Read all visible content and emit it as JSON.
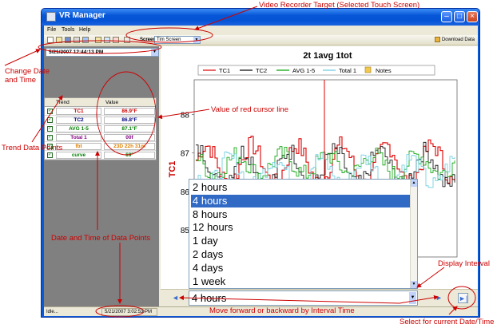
{
  "window": {
    "title": "VR Manager",
    "minimize_glyph": "–",
    "maximize_glyph": "□",
    "close_glyph": "×"
  },
  "menu": {
    "file": "File",
    "tools": "Tools",
    "help": "Help"
  },
  "toolbar": {
    "screen_label": "Screen:",
    "screen_value": "Tim Screen",
    "download_label": "Download Data",
    "dropdown_glyph": "▼"
  },
  "left": {
    "date_value": "5/21/2007 12:44:13 PM",
    "table_headers": {
      "trend": "Trend",
      "value": "Value"
    },
    "check_glyph": "✓",
    "trends": [
      {
        "name": "TC1",
        "value": "86.9°F",
        "color": "#cc0000"
      },
      {
        "name": "TC2",
        "value": "86.8°F",
        "color": "#000080"
      },
      {
        "name": "AVG 1-5",
        "value": "87.1°F",
        "color": "#008000"
      },
      {
        "name": "Total 1",
        "value": "00f",
        "color": "#800080"
      },
      {
        "name": "fbt",
        "value": "23D 22h 31m",
        "color": "#e08000"
      },
      {
        "name": "curve",
        "value": "69°",
        "color": "#008000"
      }
    ]
  },
  "status": {
    "left": "Idle...",
    "right": "5/21/2007 3:02:53 PM"
  },
  "chart": {
    "legend": {
      "tc1": "TC1",
      "tc2": "TC2",
      "avg": "AVG 1-5",
      "total": "Total 1",
      "notes": "Notes"
    }
  },
  "chart_data": {
    "type": "line",
    "title": "2t 1avg 1tot",
    "ylabel": "TC1",
    "y_ticks": [
      85,
      86,
      87,
      88
    ],
    "ylim": [
      84.3,
      88.9
    ],
    "cursor_y": 88.5,
    "series": [
      {
        "name": "TC1",
        "color": "#dd0000"
      },
      {
        "name": "TC2",
        "color": "#000000"
      },
      {
        "name": "AVG 1-5",
        "color": "#00a000"
      },
      {
        "name": "Total 1",
        "color": "#66ccdd"
      }
    ]
  },
  "interval": {
    "options": [
      "2 hours",
      "4 hours",
      "8 hours",
      "12 hours",
      "1 day",
      "2 days",
      "4 days",
      "1 week"
    ],
    "selected": "4 hours",
    "selected_index": 1
  },
  "nav": {
    "back": "◄",
    "forward": "►",
    "now": "►|"
  },
  "annotations": {
    "video_recorder": "Video Recorder Target (Selected Touch Screen)",
    "change_date": "Change Date\nand Time",
    "cursor_value": "Value of red cursor line",
    "trend_points": "Trend Data Points",
    "date_time_points": "Date and Time of Data Points",
    "display_interval": "Display Interval",
    "move": "Move forward or backward by Interval Time",
    "select_current": "Select for current Date/Time"
  },
  "colors": {
    "annotation": "#cc0000",
    "titlebar": "#0a5ad8",
    "selection": "#316ac5"
  }
}
